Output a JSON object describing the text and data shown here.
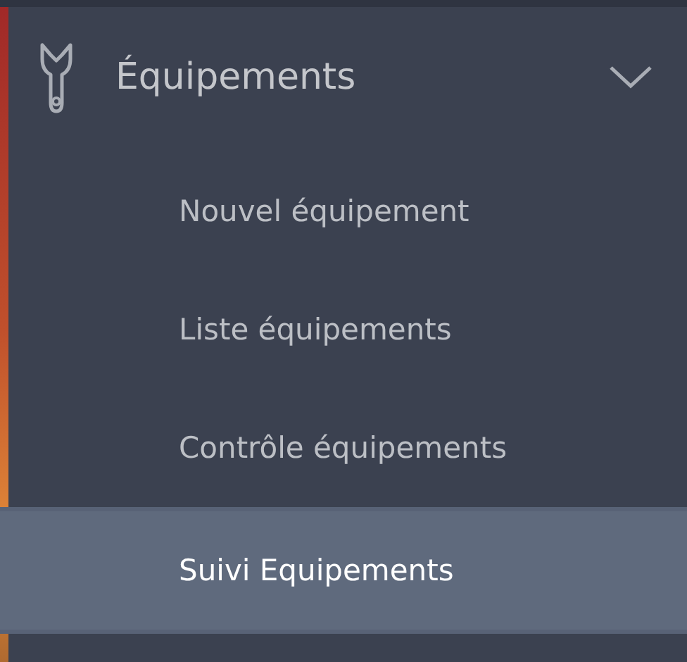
{
  "menu": {
    "label": "Équipements",
    "expanded": true,
    "children": [
      {
        "label": "Nouvel équipement",
        "selected": false
      },
      {
        "label": "Liste équipements",
        "selected": false
      },
      {
        "label": "Contrôle équipements",
        "selected": false
      },
      {
        "label": "Suivi Equipements",
        "selected": true
      }
    ]
  }
}
